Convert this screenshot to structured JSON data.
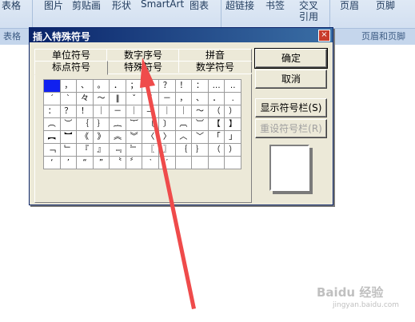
{
  "ribbon": {
    "items": [
      "表格",
      "图片",
      "剪贴画",
      "形状",
      "SmartArt",
      "图表",
      "超链接",
      "书签",
      "交叉",
      "引用",
      "页眉",
      "页脚"
    ],
    "groups": [
      "表格",
      "页眉和页脚"
    ]
  },
  "dialog": {
    "title": "插入特殊符号",
    "close_glyph": "×",
    "tabs_back": [
      "单位符号",
      "数字序号",
      "拼音"
    ],
    "tabs_front": [
      "标点符号",
      "特殊符号",
      "数学符号"
    ],
    "grid": [
      [
        "",
        "，",
        "、",
        "。",
        "．",
        "；",
        "：",
        "？",
        "！",
        "：",
        "…",
        "‥"
      ],
      [
        "´",
        "ˋ",
        "々",
        "～",
        "‖",
        "ˇ",
        "¨",
        "－",
        "，",
        "、",
        "．",
        "."
      ],
      [
        "：",
        "？",
        "！",
        "｜",
        "－",
        "｜",
        "—",
        "｜",
        "｜",
        "～",
        "（",
        "）"
      ],
      [
        "︵",
        "︶",
        "｛",
        "｝",
        "︷",
        "︸",
        "〔",
        "〕",
        "︹",
        "︺",
        "【",
        "】"
      ],
      [
        "︻",
        "︼",
        "《",
        "》",
        "︽",
        "︾",
        "〈",
        "〉",
        "︿",
        "﹀",
        "「",
        "」"
      ],
      [
        "﹁",
        "﹂",
        "『",
        "』",
        "﹃",
        "﹄",
        "〖",
        "〗",
        "｛",
        "｝",
        "（",
        "）"
      ],
      [
        "‘",
        "’",
        "“",
        "”",
        "〝",
        "〞",
        "‵",
        "′",
        "",
        "",
        "",
        ""
      ]
    ],
    "buttons": {
      "ok": "确定",
      "cancel": "取消",
      "show_toolbar": "显示符号栏(S)",
      "reset_toolbar": "重设符号栏(R)"
    }
  },
  "watermark": {
    "text": "Baidu 经验",
    "sub": "jingyan.baidu.com"
  }
}
